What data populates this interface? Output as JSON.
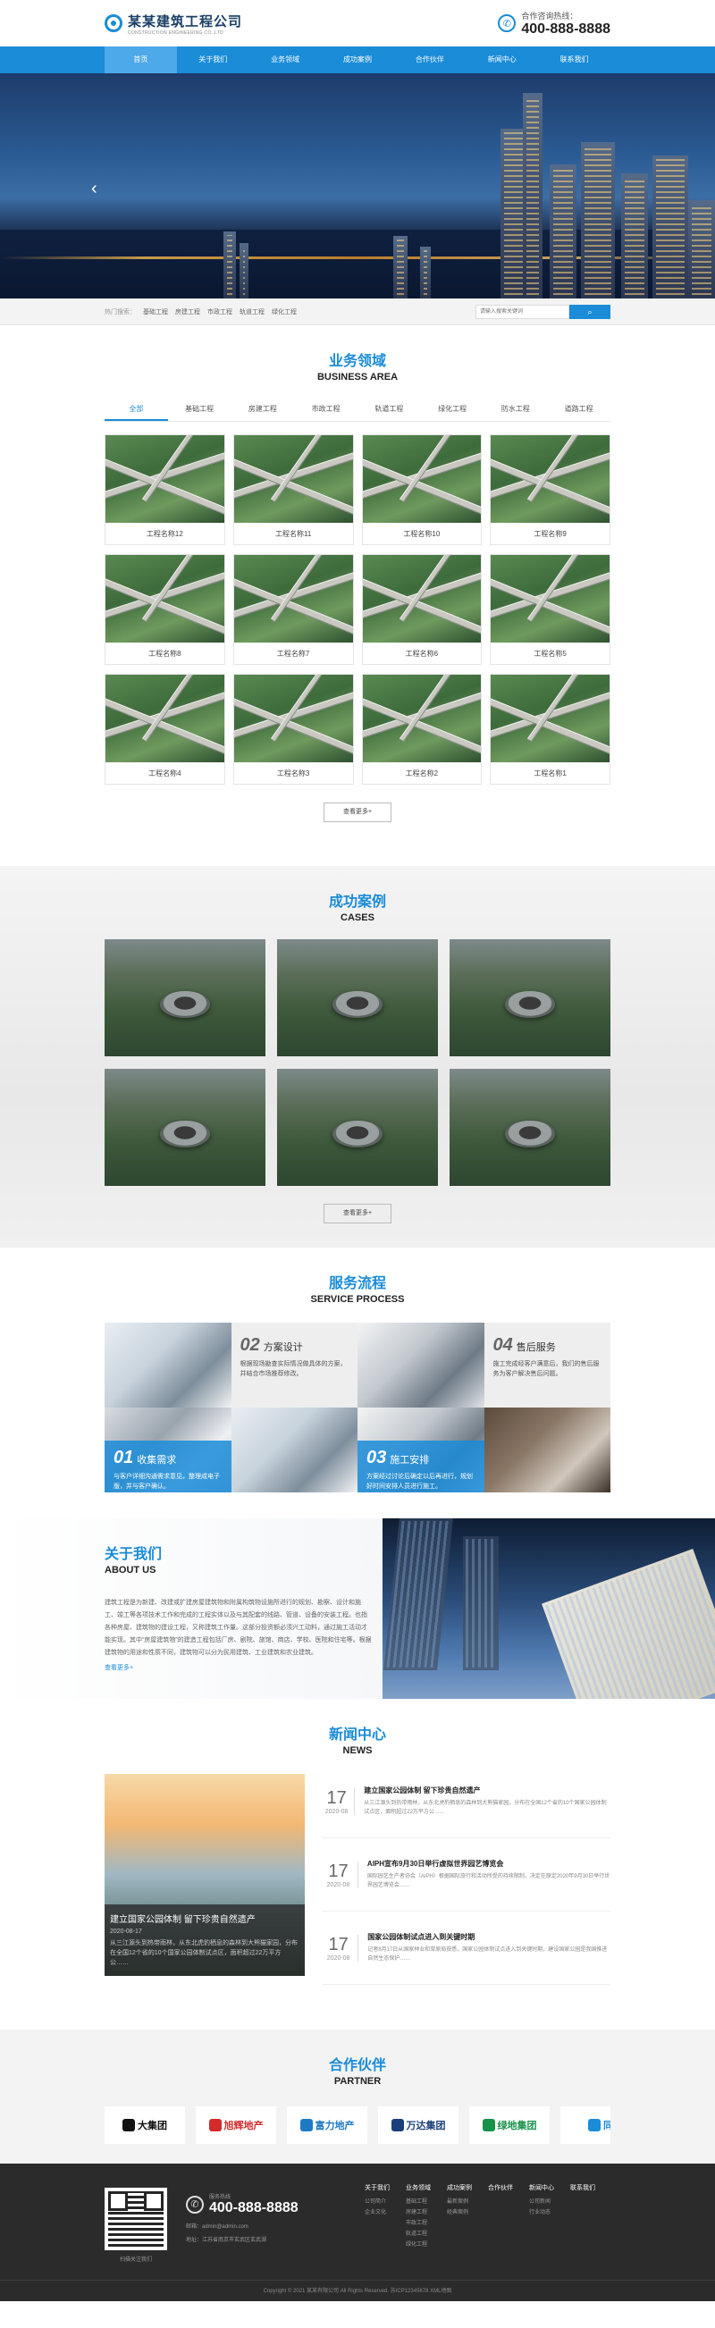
{
  "header": {
    "logo_title": "某某建筑工程公司",
    "logo_sub": "CONSTRUCTION ENGINEERING CO.,LTD",
    "hotline_label": "合作咨询热线：",
    "hotline_number": "400-888-8888"
  },
  "nav": {
    "items": [
      "首页",
      "关于我们",
      "业务领域",
      "成功案例",
      "合作伙伴",
      "新闻中心",
      "联系我们"
    ],
    "active_index": 0
  },
  "search": {
    "hot_label": "热门搜索：",
    "hot_words": [
      "基础工程",
      "房建工程",
      "市政工程",
      "轨道工程",
      "绿化工程"
    ],
    "placeholder": "请输入搜索关键词"
  },
  "business": {
    "title_cn": "业务领域",
    "title_en": "BUSINESS AREA",
    "tabs": [
      "全部",
      "基础工程",
      "房建工程",
      "市政工程",
      "轨道工程",
      "绿化工程",
      "防水工程",
      "道路工程"
    ],
    "active_tab": 0,
    "projects": [
      "工程名称12",
      "工程名称11",
      "工程名称10",
      "工程名称9",
      "工程名称8",
      "工程名称7",
      "工程名称6",
      "工程名称5",
      "工程名称4",
      "工程名称3",
      "工程名称2",
      "工程名称1"
    ],
    "more": "查看更多+"
  },
  "cases": {
    "title_cn": "成功案例",
    "title_en": "CASES",
    "more": "查看更多+"
  },
  "process": {
    "title_cn": "服务流程",
    "title_en": "SERVICE PROCESS",
    "steps": [
      {
        "num": "01",
        "title": "收集需求",
        "desc": "与客户详细沟通需求意见，整理成电子版，并与客户确认。"
      },
      {
        "num": "02",
        "title": "方案设计",
        "desc": "根据现场勘查实际情况做具体的方案，并结合市场推荐修改。"
      },
      {
        "num": "03",
        "title": "施工安排",
        "desc": "方案经过讨论后确定以后再进行，规划好时间安排人员进行施工。"
      },
      {
        "num": "04",
        "title": "售后服务",
        "desc": "施工完成经客户满意后，我们的售后服务为客户解决售后问题。"
      }
    ]
  },
  "about": {
    "title_cn": "关于我们",
    "title_en": "ABOUT US",
    "desc": "建筑工程是为新建、改建或扩建房屋建筑物和附属构筑物设施所进行的规划、勘察、设计和施工、竣工等各项技术工作和完成的工程实体以及与其配套的线路、管道、设备的安装工程。也指各种房屋、建筑物的建设工程，又称建筑工作量。这部分投资额必须兴工动料，通过施工活动才能实现。其中“房屋建筑物”的建造工程包括厂房、剧院、旅馆、商店、学校、医院和住宅等。根据建筑物的用途和性质不同，建筑物可以分为民用建筑、工业建筑和农业建筑。",
    "more": "查看更多+"
  },
  "news": {
    "title_cn": "新闻中心",
    "title_en": "NEWS",
    "featured": {
      "title": "建立国家公园体制 留下珍贵自然遗产",
      "date": "2020-08-17",
      "summary": "从三江源头到热带雨林，从东北虎豹栖息的森林到大熊猫家园，分布在全国12个省的10个国家公园体制试点区，面积超过22万平方公……"
    },
    "items": [
      {
        "day": "17",
        "ym": "2020-08",
        "title": "建立国家公园体制 留下珍贵自然遗产",
        "summary": "从三江源头到热带雨林，从东北虎豹栖息的森林到大熊猫家园，分布在全国12个省的10个国家公园体制试点区，面积超过22万平方公……"
      },
      {
        "day": "17",
        "ym": "2020-08",
        "title": "AIPH宣布9月30日举行虚拟世界园艺博览会",
        "summary": "国际园艺生产者协会（AIPH）根据国际旅行和活动所受的持续限制，决定在原定2020年9月30日举行世界园艺博览会……"
      },
      {
        "day": "17",
        "ym": "2020-08",
        "title": "国家公园体制试点进入到关键时期",
        "summary": "记者8月17日从国家林业和草原局获悉，国家公园体制试点进入到关键时期，建设国家公园是我国推进自然生态保护……"
      }
    ]
  },
  "partner": {
    "title_cn": "合作伙伴",
    "title_en": "PARTNER",
    "logos": [
      {
        "name": "大集团",
        "color": "#111111"
      },
      {
        "name": "旭辉地产",
        "color": "#d22b2b"
      },
      {
        "name": "富力地产",
        "color": "#1f7ac4"
      },
      {
        "name": "万达集团",
        "color": "#1a3f7a"
      },
      {
        "name": "绿地集团",
        "color": "#18924a"
      },
      {
        "name": "同",
        "color": "#1a8cd8"
      }
    ]
  },
  "footer": {
    "qr_label": "扫描关注我们",
    "phone_label": "服务热线",
    "phone": "400-888-8888",
    "email": "邮箱：admin@admin.com",
    "address": "地址：江苏省南京市玄武区玄武湖",
    "columns": [
      {
        "heading": "关于我们",
        "items": [
          "公司简介",
          "企业文化"
        ]
      },
      {
        "heading": "业务领域",
        "items": [
          "基础工程",
          "房建工程",
          "市政工程",
          "轨道工程",
          "绿化工程"
        ]
      },
      {
        "heading": "成功案例",
        "items": [
          "最新案例",
          "经典案例"
        ]
      },
      {
        "heading": "合作伙伴",
        "items": []
      },
      {
        "heading": "新闻中心",
        "items": [
          "公司新闻",
          "行业动态"
        ]
      },
      {
        "heading": "联系我们",
        "items": []
      }
    ],
    "copyright": "Copyright © 2021 某某有限公司 All Rights Reserved.  苏ICP12345678 XML地图"
  },
  "colors": {
    "primary": "#1a8cd8",
    "footer_bg": "#2b2b2b"
  }
}
